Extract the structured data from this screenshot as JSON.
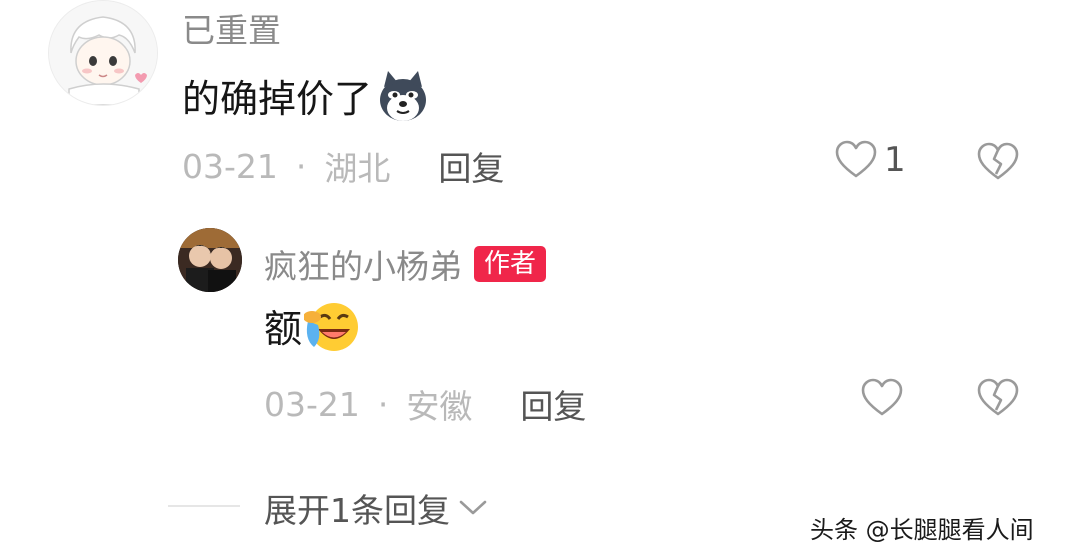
{
  "comment": {
    "username": "已重置",
    "text": "的确掉价了",
    "emoji": "dog-meme-emoji",
    "date": "03-21",
    "separator": "·",
    "location": "湖北",
    "reply_label": "回复",
    "like_count": "1"
  },
  "reply": {
    "username": "疯狂的小杨弟",
    "badge": "作者",
    "text": "额",
    "emoji": "laugh-crying-emoji",
    "date": "03-21",
    "separator": "·",
    "location": "安徽",
    "reply_label": "回复"
  },
  "expand": {
    "label": "展开1条回复"
  },
  "watermark": {
    "text": "头条 @长腿腿看人间"
  },
  "colors": {
    "badge": "#f0264a",
    "muted": "#b9b9b9",
    "secondary": "#8a8a8a",
    "body": "#161616"
  }
}
